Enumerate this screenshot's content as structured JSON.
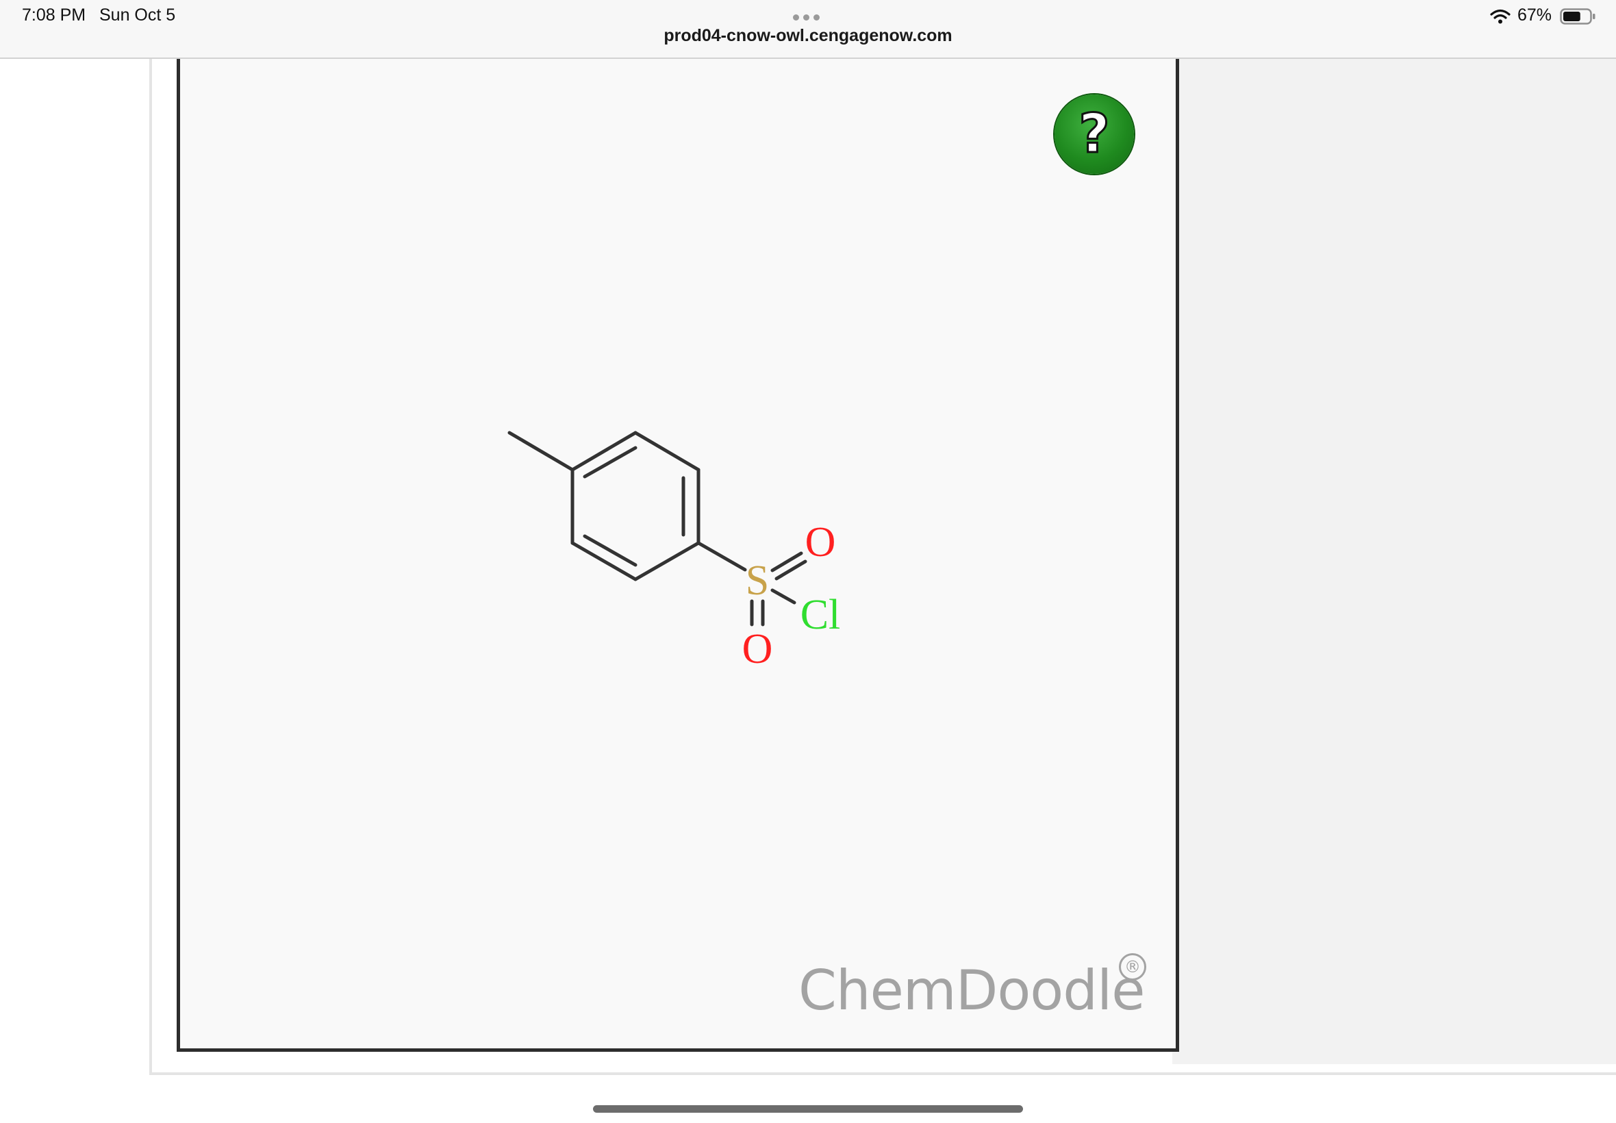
{
  "status_bar": {
    "time": "7:08 PM",
    "date": "Sun Oct 5",
    "battery_percent": "67%",
    "battery_level": 0.67,
    "url": "prod04-cnow-owl.cengagenow.com"
  },
  "canvas": {
    "help_label": "?",
    "watermark": "ChemDoodle",
    "registered_mark": "®"
  },
  "molecule": {
    "atoms": {
      "oxygen_top": "O",
      "sulfur": "S",
      "chlorine": "Cl",
      "oxygen_bottom": "O"
    },
    "colors": {
      "bond": "#333333",
      "oxygen": "#ff2020",
      "sulfur": "#c8a24a",
      "chlorine": "#30dd30"
    }
  },
  "colors": {
    "help_button": "#1f8a1f",
    "watermark": "#a3a3a3"
  }
}
